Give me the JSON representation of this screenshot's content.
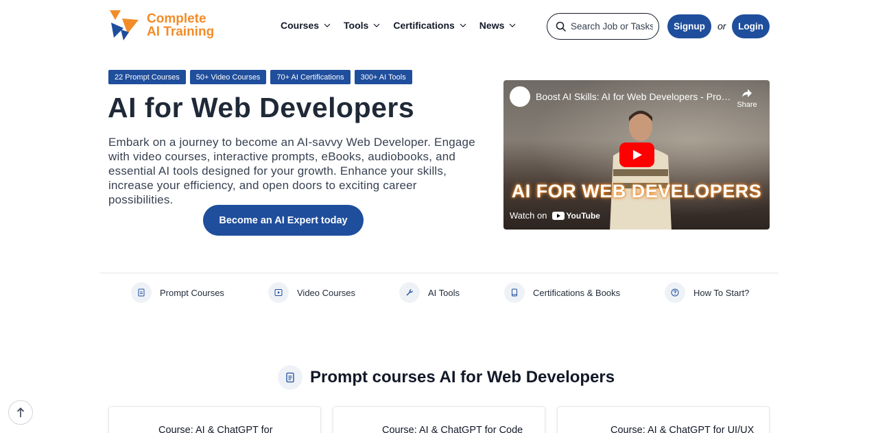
{
  "brand": {
    "line1": "Complete",
    "line2": "AI Training"
  },
  "nav": [
    {
      "label": "Courses"
    },
    {
      "label": "Tools"
    },
    {
      "label": "Certifications"
    },
    {
      "label": "News"
    }
  ],
  "search": {
    "placeholder": "Search Job or Tasks"
  },
  "auth": {
    "signup": "Signup",
    "or": "or",
    "login": "Login"
  },
  "tags": [
    "22 Prompt Courses",
    "50+ Video Courses",
    "70+ AI Certifications",
    "300+ AI Tools"
  ],
  "hero": {
    "title": "AI for Web Developers",
    "description": "Embark on a journey to become an AI-savvy Web Developer. Engage with video courses, interactive prompts, eBooks, audiobooks, and essential AI tools designed for your growth. Enhance your skills, increase your efficiency, and open doors to exciting career possibilities.",
    "cta": "Become an AI Expert today"
  },
  "video": {
    "title": "Boost AI Skills: AI for Web Developers - Prom...",
    "share": "Share",
    "overlay": "AI FOR WEB DEVELOPERS",
    "watch_on": "Watch on",
    "youtube": "YouTube"
  },
  "subnav": [
    {
      "label": "Prompt Courses",
      "icon": "document-icon"
    },
    {
      "label": "Video Courses",
      "icon": "play-icon"
    },
    {
      "label": "AI Tools",
      "icon": "wrench-icon"
    },
    {
      "label": "Certifications & Books",
      "icon": "book-icon"
    },
    {
      "label": "How To Start?",
      "icon": "question-icon"
    }
  ],
  "section": {
    "title": "Prompt courses AI for Web Developers"
  },
  "cards": [
    {
      "title": "Course: AI & ChatGPT for"
    },
    {
      "title": "Course: AI & ChatGPT for Code"
    },
    {
      "title": "Course: AI & ChatGPT for UI/UX"
    }
  ],
  "colors": {
    "primary": "#1f4e9c",
    "brand_orange": "#f28c28"
  }
}
